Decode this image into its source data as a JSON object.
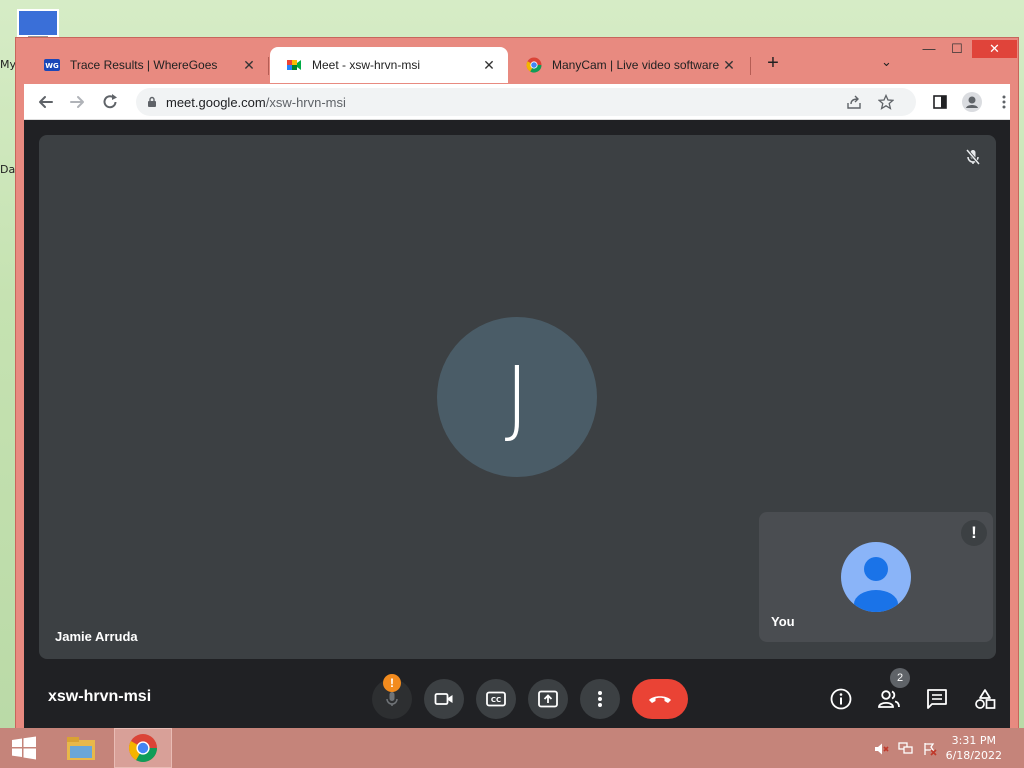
{
  "desktop": {
    "labels": [
      "My",
      "Da"
    ]
  },
  "browser": {
    "tabs": [
      {
        "title": "Trace Results | WhereGoes",
        "favicon": "wheregoes-icon",
        "active": false
      },
      {
        "title": "Meet - xsw-hrvn-msi",
        "favicon": "google-meet-icon",
        "active": true
      },
      {
        "title": "ManyCam | Live video software &",
        "favicon": "chrome-icon",
        "active": false
      }
    ],
    "close_glyph": "✕",
    "new_tab_glyph": "+",
    "tab_list_glyph": "⌄",
    "window_buttons": {
      "minimize": "—",
      "maximize": "☐",
      "close": "✕"
    },
    "address": {
      "host": "meet.google.com",
      "path": "/xsw-hrvn-msi"
    }
  },
  "meet": {
    "participant_initial": "J",
    "participant_name": "Jamie Arruda",
    "self_label": "You",
    "self_warning": "!",
    "meeting_code": "xsw-hrvn-msi",
    "mic_warning": "!",
    "people_count": "2",
    "colors": {
      "stage": "#3c4043",
      "avatar": "#4a5c67",
      "end_call": "#ea4335",
      "warning": "#f28b1e",
      "self_avatar": "#8ab4f8"
    }
  },
  "taskbar": {
    "time": "3:31 PM",
    "date": "6/18/2022"
  }
}
